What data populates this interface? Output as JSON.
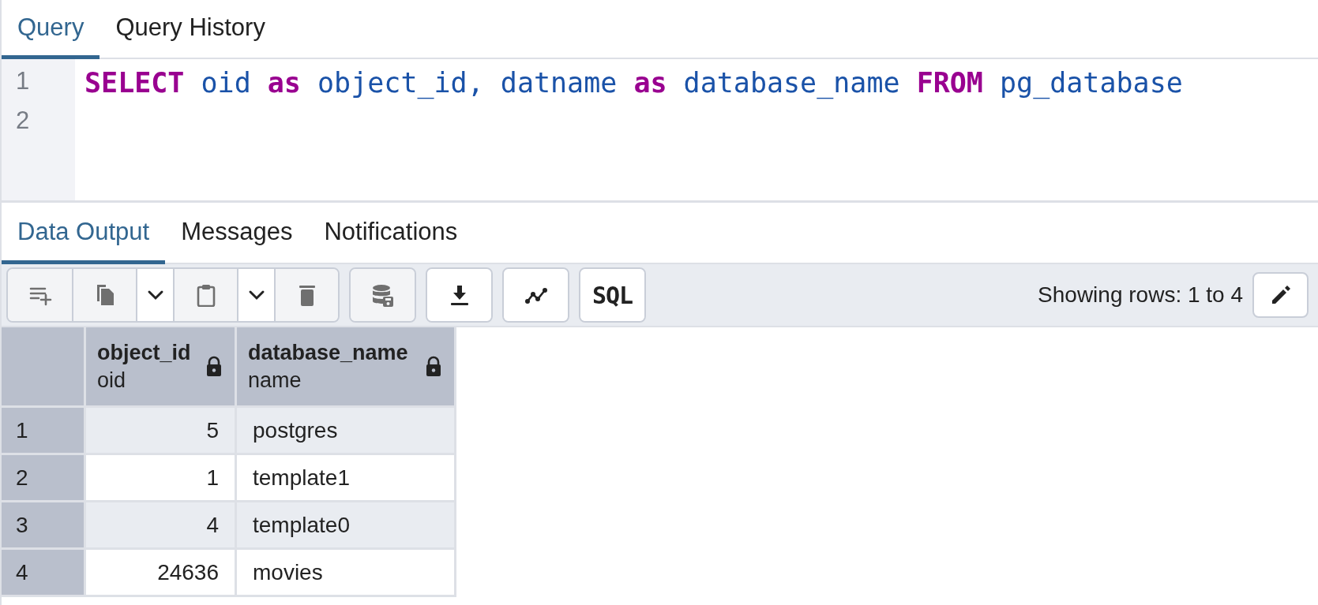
{
  "query_tabs": [
    {
      "label": "Query",
      "selected": true
    },
    {
      "label": "Query History",
      "selected": false
    }
  ],
  "editor": {
    "lines": [
      {
        "number": "1",
        "tokens": [
          {
            "text": "SELECT",
            "kind": "keyword"
          },
          {
            "text": " oid ",
            "kind": "name"
          },
          {
            "text": "as",
            "kind": "keyword"
          },
          {
            "text": " object_id, datname ",
            "kind": "name"
          },
          {
            "text": "as",
            "kind": "keyword"
          },
          {
            "text": " database_name ",
            "kind": "name"
          },
          {
            "text": "FROM",
            "kind": "keyword"
          },
          {
            "text": " pg_database",
            "kind": "name"
          }
        ]
      },
      {
        "number": "2"
      }
    ]
  },
  "output_tabs": [
    {
      "label": "Data Output",
      "selected": true
    },
    {
      "label": "Messages",
      "selected": false
    },
    {
      "label": "Notifications",
      "selected": false
    }
  ],
  "toolbar": {
    "groups": [
      [
        {
          "kind": "add-row",
          "disabled": true
        },
        {
          "kind": "copy",
          "disabled": true
        },
        {
          "kind": "caret",
          "disabled": false
        },
        {
          "kind": "paste",
          "disabled": true
        },
        {
          "kind": "caret",
          "disabled": false
        },
        {
          "kind": "delete",
          "disabled": true
        }
      ],
      [
        {
          "kind": "save-data",
          "disabled": true
        }
      ],
      [
        {
          "kind": "download",
          "disabled": false
        }
      ],
      [
        {
          "kind": "graph",
          "disabled": false
        }
      ],
      [
        {
          "kind": "sql",
          "label": "SQL",
          "disabled": false
        }
      ]
    ],
    "status": "Showing rows: 1 to 4",
    "edit_button": {
      "kind": "edit",
      "disabled": false
    }
  },
  "table": {
    "columns": [
      {
        "name": "object_id",
        "type": "oid",
        "kind": "number"
      },
      {
        "name": "database_name",
        "type": "name",
        "kind": "text"
      }
    ],
    "rows": [
      {
        "number": "1",
        "cells": [
          "5",
          "postgres"
        ]
      },
      {
        "number": "2",
        "cells": [
          "1",
          "template1"
        ]
      },
      {
        "number": "3",
        "cells": [
          "4",
          "template0"
        ]
      },
      {
        "number": "4",
        "cells": [
          "24636",
          "movies"
        ]
      }
    ]
  }
}
